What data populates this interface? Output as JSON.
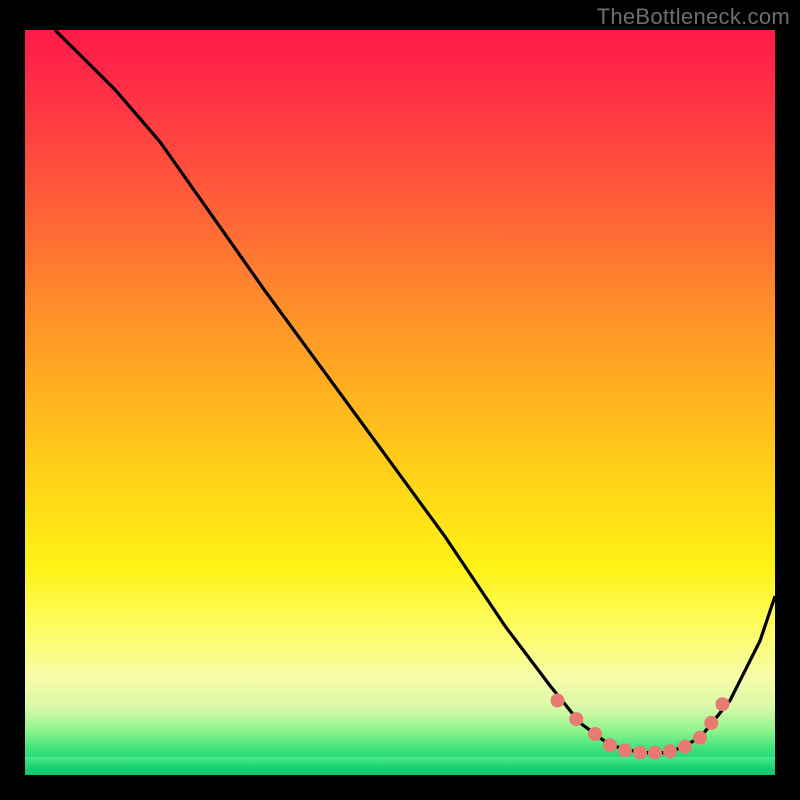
{
  "watermark": "TheBottleneck.com",
  "chart_data": {
    "type": "line",
    "title": "",
    "xlabel": "",
    "ylabel": "",
    "xlim": [
      0,
      100
    ],
    "ylim": [
      0,
      100
    ],
    "grid": false,
    "legend": false,
    "notes": "Background is a vertical red→yellow→green gradient. A single black curve descends from top-left, reaches a flat minimum around x≈78–88 near y≈3, then rises toward the right edge. Salmon-colored dots mark points along the valley.",
    "series": [
      {
        "name": "curve",
        "color": "#000000",
        "x": [
          4,
          8,
          12,
          18,
          25,
          32,
          40,
          48,
          56,
          64,
          70,
          74,
          78,
          82,
          86,
          90,
          94,
          98,
          100
        ],
        "y": [
          100,
          96,
          92,
          85,
          75,
          65,
          54,
          43,
          32,
          20,
          12,
          7,
          4,
          3,
          3,
          5,
          10,
          18,
          24
        ]
      },
      {
        "name": "markers",
        "color": "#e77b72",
        "type": "scatter",
        "x": [
          71,
          73.5,
          76,
          78,
          80,
          82,
          84,
          86,
          88,
          90,
          91.5,
          93
        ],
        "y": [
          10,
          7.5,
          5.5,
          4,
          3.3,
          3,
          3,
          3.2,
          3.8,
          5,
          7,
          9.5
        ]
      }
    ]
  }
}
